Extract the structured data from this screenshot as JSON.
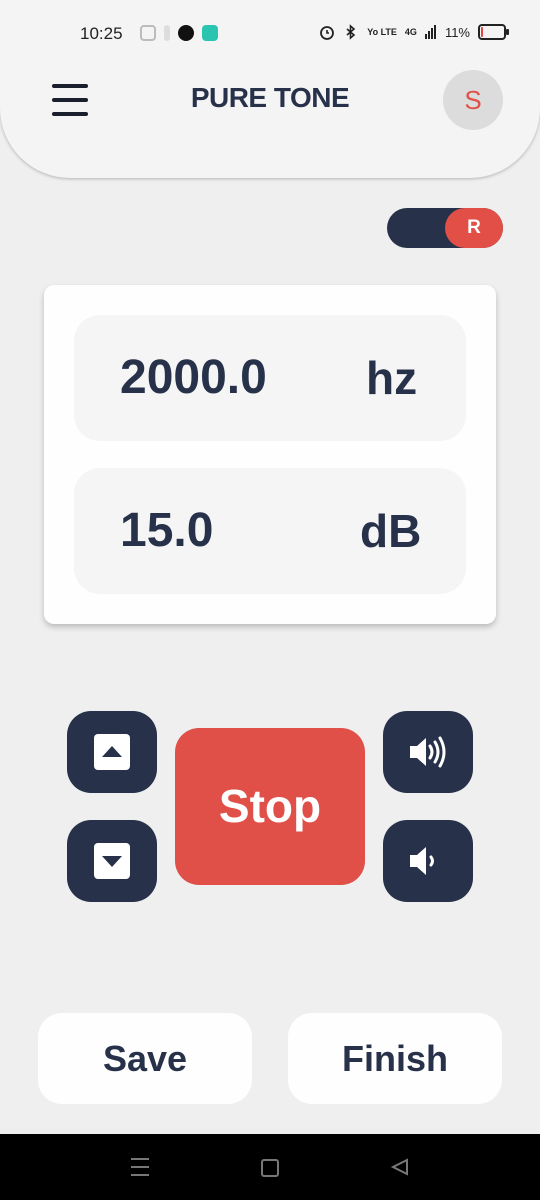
{
  "status_bar": {
    "time": "10:25",
    "battery_percent": "11%",
    "battery_level": 0.11,
    "net_label": "4G",
    "volte_label": "Yo LTE",
    "icons": [
      "notification-icon",
      "spotify-icon",
      "chat-icon",
      "alarm-icon",
      "bluetooth-icon",
      "signal-icon",
      "battery-icon"
    ]
  },
  "header": {
    "title": "PURE TONE",
    "avatar_letter": "S",
    "menu_icon": "hamburger-menu-icon"
  },
  "ear_toggle": {
    "label": "R",
    "selected": "right"
  },
  "readout": {
    "frequency_value": "2000.0",
    "frequency_unit": "hz",
    "level_value": "15.0",
    "level_unit": "dB"
  },
  "controls": {
    "frequency_up_icon": "caret-up-icon",
    "frequency_down_icon": "caret-down-icon",
    "volume_up_icon": "volume-up-icon",
    "volume_down_icon": "volume-down-icon",
    "stop_label": "Stop"
  },
  "actions": {
    "save_label": "Save",
    "finish_label": "Finish"
  },
  "colors": {
    "navy": "#27324a",
    "accent_red": "#e04f48",
    "background": "#efefef",
    "card": "#fefefe"
  },
  "nav_bar": {
    "icons": [
      "recents-icon",
      "home-icon",
      "back-icon"
    ]
  }
}
